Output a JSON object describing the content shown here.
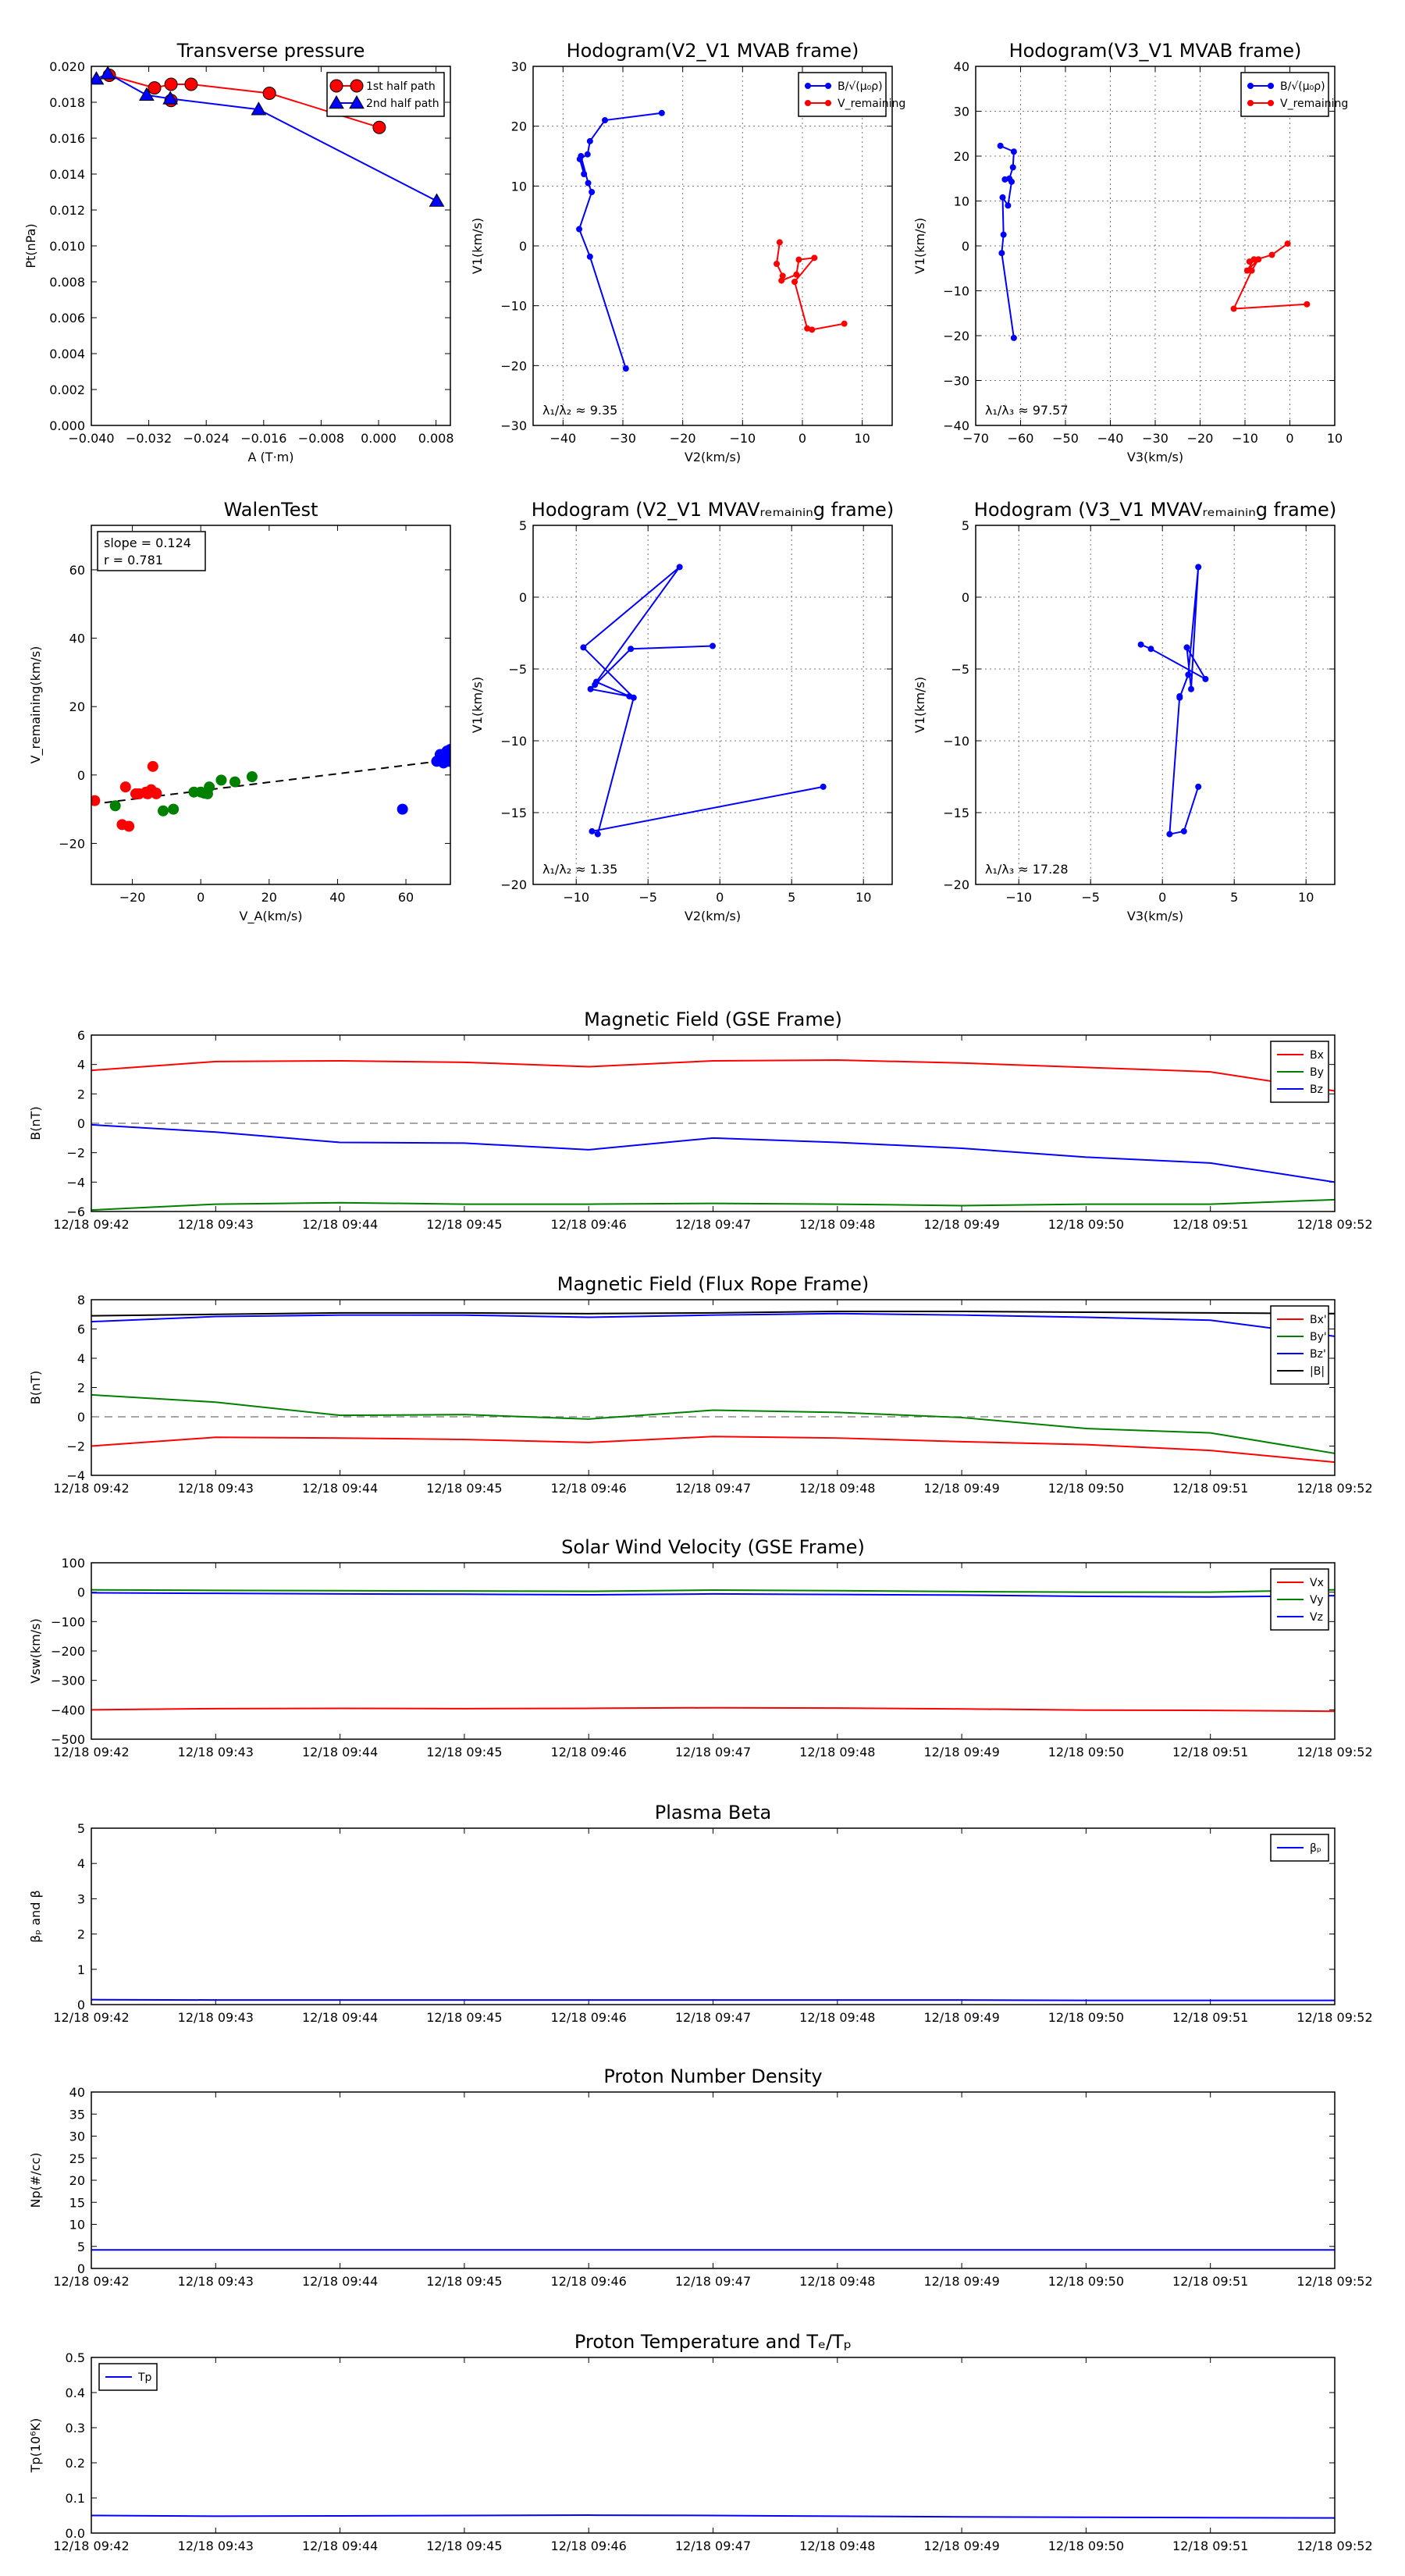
{
  "chart_data": [
    {
      "id": "transverse-pressure",
      "type": "line",
      "title": "Transverse pressure",
      "xlabel": "A (T·m)",
      "ylabel": "Pt(nPa)",
      "xlim": [
        -0.04,
        0.01
      ],
      "ylim": [
        0,
        0.02
      ],
      "x_ticks": [
        "−0.040",
        "−0.032",
        "−0.024",
        "−0.016",
        "−0.008",
        "0.000",
        "0.008"
      ],
      "y_ticks": [
        "0.000",
        "0.002",
        "0.004",
        "0.006",
        "0.008",
        "0.010",
        "0.012",
        "0.014",
        "0.016",
        "0.018",
        "0.020"
      ],
      "grid": false,
      "legend": "top-right",
      "series": [
        {
          "name": "1st half path",
          "color": "#ff0000",
          "marker": "circle",
          "x": [
            -0.0375,
            -0.0312,
            -0.0289,
            -0.0261,
            -0.0152,
            0.0001
          ],
          "y": [
            0.0195,
            0.0188,
            0.019,
            0.019,
            0.0185,
            0.0166
          ],
          "x2": [
            -0.0289
          ],
          "y2": [
            0.0181
          ]
        },
        {
          "name": "2nd half path",
          "color": "#0000ff",
          "marker": "triangle",
          "x": [
            -0.0393,
            -0.0377,
            -0.0323,
            -0.029,
            -0.0167,
            0.0081
          ],
          "y": [
            0.0193,
            0.0196,
            0.0184,
            0.0182,
            0.0176,
            0.0125
          ]
        }
      ]
    },
    {
      "id": "hodogram-v2-v1-mvab",
      "type": "line",
      "title": "Hodogram(V2_V1 MVAB frame)",
      "xlabel": "V2(km/s)",
      "ylabel": "V1(km/s)",
      "xlim": [
        -45,
        15
      ],
      "ylim": [
        -30,
        30
      ],
      "x_ticks": [
        "−40",
        "−30",
        "−20",
        "−10",
        "0",
        "10"
      ],
      "y_ticks": [
        "−30",
        "−20",
        "−10",
        "0",
        "10",
        "20",
        "30"
      ],
      "grid": true,
      "legend": "top-right",
      "annotation": "λ₁/λ₂ ≈ 9.35",
      "series": [
        {
          "name": "B/√(μ₀ρ)",
          "color": "#0000ff",
          "x": [
            -23.5,
            -33,
            -35.5,
            -35.9,
            -37.2,
            -36.5,
            -37.0,
            -35.8,
            -35.2,
            -37.3,
            -35.5,
            -29.5
          ],
          "y": [
            22.2,
            21,
            17.5,
            15.3,
            14.5,
            12,
            15,
            10.5,
            9,
            2.8,
            -1.8,
            -20.5
          ]
        },
        {
          "name": "V_remaining",
          "color": "#ff0000",
          "x": [
            -3.8,
            -4.3,
            -3.3,
            -3.5,
            -1,
            -0.6,
            2,
            -1.3,
            0.8,
            1.6,
            7
          ],
          "y": [
            0.6,
            -3,
            -5,
            -5.8,
            -4.8,
            -2.3,
            -2,
            -6,
            -13.8,
            -14,
            -13
          ]
        }
      ]
    },
    {
      "id": "hodogram-v3-v1-mvab",
      "type": "line",
      "title": "Hodogram(V3_V1 MVAB frame)",
      "xlabel": "V3(km/s)",
      "ylabel": "V1(km/s)",
      "xlim": [
        -70,
        10
      ],
      "ylim": [
        -40,
        40
      ],
      "x_ticks": [
        "−70",
        "−60",
        "−50",
        "−40",
        "−30",
        "−20",
        "−10",
        "0",
        "10"
      ],
      "y_ticks": [
        "−40",
        "−30",
        "−20",
        "−10",
        "0",
        "10",
        "20",
        "30",
        "40"
      ],
      "grid": true,
      "legend": "top-right",
      "annotation": "λ₁/λ₃ ≈ 97.57",
      "series": [
        {
          "name": "B/√(μ₀ρ)",
          "color": "#0000ff",
          "x": [
            -64.5,
            -61.5,
            -61.7,
            -62.5,
            -63.5,
            -62,
            -62.8,
            -64,
            -63.8,
            -64.2,
            -61.5
          ],
          "y": [
            22.3,
            21,
            17.5,
            15,
            14.8,
            14.3,
            9,
            10.8,
            2.5,
            -1.6,
            -20.5
          ]
        },
        {
          "name": "V_remaining",
          "color": "#ff0000",
          "x": [
            -0.5,
            -4,
            -9,
            -8,
            -9.5,
            -7,
            -8.5,
            -12.5,
            3.8
          ],
          "y": [
            0.5,
            -2,
            -3.5,
            -3,
            -5.5,
            -3,
            -5.5,
            -14,
            -13
          ]
        }
      ]
    },
    {
      "id": "walen-test",
      "type": "scatter",
      "title": "WalenTest",
      "xlabel": "V_A(km/s)",
      "ylabel": "V_remaining(km/s)",
      "xlim": [
        -32,
        73
      ],
      "ylim": [
        -32,
        73
      ],
      "x_ticks": [
        "−20",
        "0",
        "20",
        "40",
        "60"
      ],
      "y_ticks": [
        "−20",
        "0",
        "20",
        "40",
        "60"
      ],
      "grid": false,
      "annotation": [
        "slope = 0.124",
        "r = 0.781"
      ],
      "fit": {
        "slope": 0.124,
        "intercept": -4.6
      },
      "series": [
        {
          "name": "",
          "color": "#ff0000",
          "x": [
            -31,
            -23,
            -21,
            -19,
            -18,
            -16,
            -15.5,
            -14,
            -13,
            -14.5,
            -22,
            -13
          ],
          "y": [
            -7.5,
            -14.5,
            -15,
            -5.5,
            -5.5,
            -5,
            -5.5,
            2.5,
            -5.3,
            -4.3,
            -3.5,
            -5.5
          ]
        },
        {
          "name": "",
          "color": "#008000",
          "x": [
            -25,
            -11,
            -8,
            -2,
            0,
            1,
            2,
            2.5,
            6,
            10,
            15
          ],
          "y": [
            -9,
            -10.5,
            -10,
            -5,
            -5,
            -5.3,
            -5.5,
            -3.5,
            -1.5,
            -2,
            -0.5
          ]
        },
        {
          "name": "",
          "color": "#0000ff",
          "x": [
            59,
            69,
            70,
            71,
            72,
            73,
            71.5,
            72.5
          ],
          "y": [
            -10,
            4,
            6,
            3.5,
            7,
            7.5,
            5,
            4
          ]
        }
      ]
    },
    {
      "id": "hodogram-v2-v1-mvav",
      "type": "line",
      "title": "Hodogram (V2_V1 MVAVᵣₑₘₐᵢₙᵢₙg frame)",
      "xlabel": "V2(km/s)",
      "ylabel": "V1(km/s)",
      "xlim": [
        -13,
        12
      ],
      "ylim": [
        -20,
        5
      ],
      "x_ticks": [
        "−10",
        "−5",
        "0",
        "5",
        "10"
      ],
      "y_ticks": [
        "−20",
        "−15",
        "−10",
        "−5",
        "0",
        "5"
      ],
      "grid": true,
      "annotation": "λ₁/λ₂ ≈ 1.35",
      "series": [
        {
          "name": "",
          "color": "#0000ff",
          "x": [
            -0.5,
            -6.2,
            -8.7,
            -9.0,
            -6.3,
            -8.6,
            -2.8,
            -9.5,
            -6.0,
            -8.5,
            -8.9,
            7.2
          ],
          "y": [
            -3.4,
            -3.6,
            -6.1,
            -6.4,
            -6.9,
            -5.9,
            2.1,
            -3.5,
            -7,
            -16.5,
            -16.3,
            -13.2
          ]
        }
      ]
    },
    {
      "id": "hodogram-v3-v1-mvav",
      "type": "line",
      "title": "Hodogram (V3_V1 MVAVᵣₑₘₐᵢₙᵢₙg frame)",
      "xlabel": "V3(km/s)",
      "ylabel": "V1(km/s)",
      "xlim": [
        -13,
        12
      ],
      "ylim": [
        -20,
        5
      ],
      "x_ticks": [
        "−10",
        "−5",
        "0",
        "5",
        "10"
      ],
      "y_ticks": [
        "−20",
        "−15",
        "−10",
        "−5",
        "0",
        "5"
      ],
      "grid": true,
      "annotation": "λ₁/λ₃ ≈ 17.28",
      "series": [
        {
          "name": "",
          "color": "#0000ff",
          "x": [
            -1.5,
            -0.8,
            3,
            1.7,
            2,
            2.5,
            1.8,
            1.2,
            1.2,
            0.5,
            1.5,
            2.5
          ],
          "y": [
            -3.3,
            -3.6,
            -5.7,
            -3.5,
            -6.4,
            2.1,
            -5.4,
            -7,
            -6.9,
            -16.5,
            -16.3,
            -13.2
          ]
        }
      ]
    },
    {
      "id": "magnetic-field-gse",
      "type": "line",
      "title": "Magnetic Field (GSE Frame)",
      "xlabel": "",
      "ylabel": "B(nT)",
      "ylim": [
        -6,
        6
      ],
      "y_ticks": [
        "−6",
        "−4",
        "−2",
        "0",
        "2",
        "4",
        "6"
      ],
      "x_ticks": [
        "12/18 09:42",
        "12/18 09:43",
        "12/18 09:44",
        "12/18 09:45",
        "12/18 09:46",
        "12/18 09:47",
        "12/18 09:48",
        "12/18 09:49",
        "12/18 09:50",
        "12/18 09:51",
        "12/18 09:52"
      ],
      "x": [
        0,
        1,
        2,
        3,
        4,
        5,
        6,
        7,
        8,
        9,
        10
      ],
      "zero_line": true,
      "legend": "top-right",
      "series": [
        {
          "name": "Bx",
          "color": "#ff0000",
          "values": [
            3.6,
            4.2,
            4.25,
            4.15,
            3.85,
            4.25,
            4.3,
            4.1,
            3.8,
            3.5,
            2.2
          ]
        },
        {
          "name": "By",
          "color": "#008000",
          "values": [
            -5.9,
            -5.5,
            -5.4,
            -5.5,
            -5.5,
            -5.45,
            -5.5,
            -5.6,
            -5.5,
            -5.5,
            -5.2
          ]
        },
        {
          "name": "Bz",
          "color": "#0000ff",
          "values": [
            -0.1,
            -0.6,
            -1.3,
            -1.35,
            -1.8,
            -1.0,
            -1.3,
            -1.7,
            -2.3,
            -2.7,
            -4.0
          ]
        }
      ]
    },
    {
      "id": "magnetic-field-flux-rope",
      "type": "line",
      "title": "Magnetic Field (Flux Rope Frame)",
      "xlabel": "",
      "ylabel": "B(nT)",
      "ylim": [
        -4,
        8
      ],
      "y_ticks": [
        "−4",
        "−2",
        "0",
        "2",
        "4",
        "6",
        "8"
      ],
      "x_ticks": [
        "12/18 09:42",
        "12/18 09:43",
        "12/18 09:44",
        "12/18 09:45",
        "12/18 09:46",
        "12/18 09:47",
        "12/18 09:48",
        "12/18 09:49",
        "12/18 09:50",
        "12/18 09:51",
        "12/18 09:52"
      ],
      "x": [
        0,
        1,
        2,
        3,
        4,
        5,
        6,
        7,
        8,
        9,
        10
      ],
      "zero_line": true,
      "legend": "top-right",
      "series": [
        {
          "name": "Bx'",
          "color": "#ff0000",
          "values": [
            -2.0,
            -1.4,
            -1.45,
            -1.55,
            -1.75,
            -1.35,
            -1.45,
            -1.7,
            -1.9,
            -2.3,
            -3.1
          ]
        },
        {
          "name": "By'",
          "color": "#008000",
          "values": [
            1.5,
            1.0,
            0.1,
            0.15,
            -0.15,
            0.45,
            0.3,
            -0.05,
            -0.8,
            -1.1,
            -2.5
          ]
        },
        {
          "name": "Bz'",
          "color": "#0000ff",
          "values": [
            6.5,
            6.85,
            6.95,
            6.95,
            6.8,
            6.95,
            7.05,
            6.95,
            6.8,
            6.6,
            5.5
          ]
        },
        {
          "name": "|B|",
          "color": "#000000",
          "values": [
            6.9,
            7.0,
            7.1,
            7.1,
            7.05,
            7.1,
            7.2,
            7.2,
            7.15,
            7.1,
            7.05
          ]
        }
      ]
    },
    {
      "id": "solar-wind-velocity",
      "type": "line",
      "title": "Solar Wind Velocity (GSE Frame)",
      "xlabel": "",
      "ylabel": "Vsw(km/s)",
      "ylim": [
        -500,
        100
      ],
      "y_ticks": [
        "−500",
        "−400",
        "−300",
        "−200",
        "−100",
        "0",
        "100"
      ],
      "x_ticks": [
        "12/18 09:42",
        "12/18 09:43",
        "12/18 09:44",
        "12/18 09:45",
        "12/18 09:46",
        "12/18 09:47",
        "12/18 09:48",
        "12/18 09:49",
        "12/18 09:50",
        "12/18 09:51",
        "12/18 09:52"
      ],
      "x": [
        0,
        1,
        2,
        3,
        4,
        5,
        6,
        7,
        8,
        9,
        10
      ],
      "zero_line": false,
      "legend": "top-right",
      "series": [
        {
          "name": "Vx",
          "color": "#ff0000",
          "values": [
            -400,
            -396,
            -395,
            -396,
            -395,
            -393,
            -394,
            -397,
            -401,
            -402,
            -405
          ]
        },
        {
          "name": "Vy",
          "color": "#008000",
          "values": [
            8,
            6,
            5,
            4,
            3,
            7,
            5,
            2,
            0,
            0,
            8
          ]
        },
        {
          "name": "Vz",
          "color": "#0000ff",
          "values": [
            -2,
            -4,
            -6,
            -7,
            -9,
            -6,
            -8,
            -10,
            -14,
            -16,
            -12
          ]
        }
      ]
    },
    {
      "id": "plasma-beta",
      "type": "line",
      "title": "Plasma Beta",
      "xlabel": "",
      "ylabel": "βₚ and β",
      "ylim": [
        0,
        5
      ],
      "y_ticks": [
        "0",
        "1",
        "2",
        "3",
        "4",
        "5"
      ],
      "x_ticks": [
        "12/18 09:42",
        "12/18 09:43",
        "12/18 09:44",
        "12/18 09:45",
        "12/18 09:46",
        "12/18 09:47",
        "12/18 09:48",
        "12/18 09:49",
        "12/18 09:50",
        "12/18 09:51",
        "12/18 09:52"
      ],
      "x": [
        0,
        1,
        2,
        3,
        4,
        5,
        6,
        7,
        8,
        9,
        10
      ],
      "legend": "top-right",
      "series": [
        {
          "name": "βₚ",
          "color": "#0000ff",
          "values": [
            0.14,
            0.13,
            0.13,
            0.13,
            0.13,
            0.13,
            0.13,
            0.13,
            0.12,
            0.12,
            0.12
          ]
        }
      ]
    },
    {
      "id": "proton-number-density",
      "type": "line",
      "title": "Proton Number Density",
      "xlabel": "",
      "ylabel": "Np(#/cc)",
      "ylim": [
        0,
        40
      ],
      "y_ticks": [
        "0",
        "5",
        "10",
        "15",
        "20",
        "25",
        "30",
        "35",
        "40"
      ],
      "x_ticks": [
        "12/18 09:42",
        "12/18 09:43",
        "12/18 09:44",
        "12/18 09:45",
        "12/18 09:46",
        "12/18 09:47",
        "12/18 09:48",
        "12/18 09:49",
        "12/18 09:50",
        "12/18 09:51",
        "12/18 09:52"
      ],
      "x": [
        0,
        1,
        2,
        3,
        4,
        5,
        6,
        7,
        8,
        9,
        10
      ],
      "series": [
        {
          "name": "",
          "color": "#0000ff",
          "values": [
            4.2,
            4.2,
            4.2,
            4.2,
            4.2,
            4.2,
            4.2,
            4.2,
            4.2,
            4.2,
            4.2
          ]
        }
      ]
    },
    {
      "id": "proton-temperature",
      "type": "line",
      "title": "Proton Temperature and Tₑ/Tₚ",
      "xlabel": "",
      "ylabel": "Tp(10⁶K)",
      "ylim": [
        0,
        0.5
      ],
      "y_ticks": [
        "0.0",
        "0.1",
        "0.2",
        "0.3",
        "0.4",
        "0.5"
      ],
      "x_ticks": [
        "12/18 09:42",
        "12/18 09:43",
        "12/18 09:44",
        "12/18 09:45",
        "12/18 09:46",
        "12/18 09:47",
        "12/18 09:48",
        "12/18 09:49",
        "12/18 09:50",
        "12/18 09:51",
        "12/18 09:52"
      ],
      "x": [
        0,
        1,
        2,
        3,
        4,
        5,
        6,
        7,
        8,
        9,
        10
      ],
      "legend": "top-left",
      "series": [
        {
          "name": "Tp",
          "color": "#0000ff",
          "values": [
            0.05,
            0.048,
            0.049,
            0.05,
            0.051,
            0.05,
            0.048,
            0.046,
            0.045,
            0.044,
            0.043
          ]
        }
      ]
    }
  ]
}
